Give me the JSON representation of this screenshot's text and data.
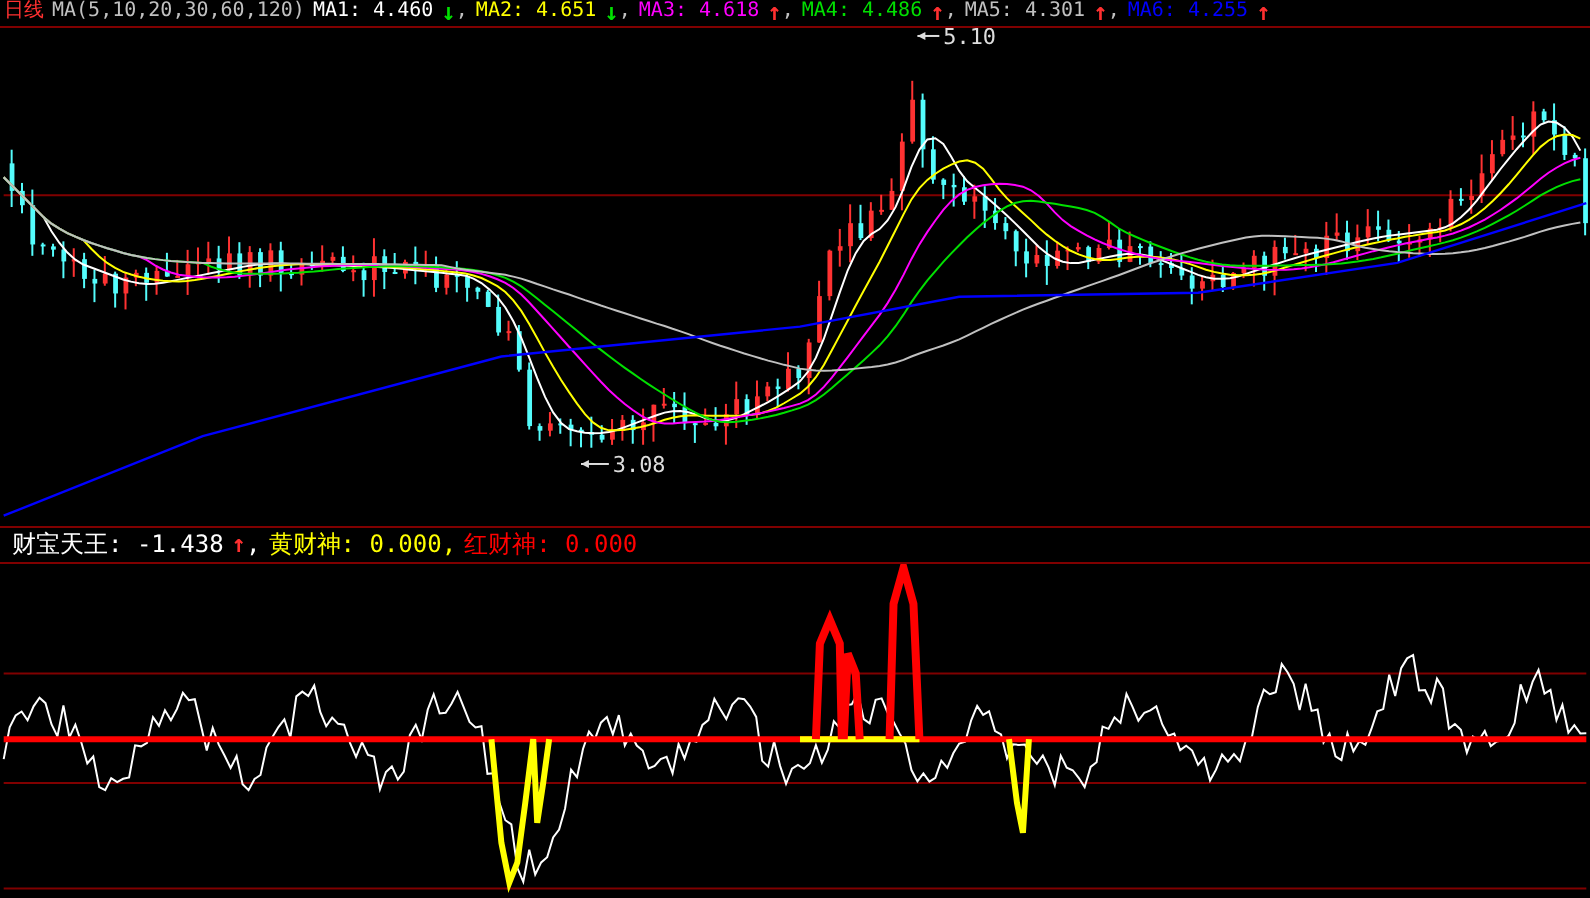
{
  "header": {
    "period": "日线",
    "ma_params": "MA(5,10,20,30,60,120)",
    "mas": [
      {
        "label": "MA1:",
        "value": "4.460",
        "arrow": {
          "glyph": "↓",
          "color": "#00e000"
        },
        "sep": ",",
        "color": "#ffffff"
      },
      {
        "label": "MA2:",
        "value": "4.651",
        "arrow": {
          "glyph": "↓",
          "color": "#00e000"
        },
        "sep": ",",
        "color": "#ffff00"
      },
      {
        "label": "MA3:",
        "value": "4.618",
        "arrow": {
          "glyph": "↑",
          "color": "#ff3030"
        },
        "sep": ",",
        "color": "#ff00ff"
      },
      {
        "label": "MA4:",
        "value": "4.486",
        "arrow": {
          "glyph": "↑",
          "color": "#ff3030"
        },
        "sep": ",",
        "color": "#00e000"
      },
      {
        "label": "MA5:",
        "value": "4.301",
        "arrow": {
          "glyph": "↑",
          "color": "#ff3030"
        },
        "sep": ",",
        "color": "#c0c0c0"
      },
      {
        "label": "MA6:",
        "value": "4.255",
        "arrow": {
          "glyph": "↑",
          "color": "#ff3030"
        },
        "color": "#0000ff"
      }
    ]
  },
  "price_chart": {
    "high_label": "5.10",
    "low_label": "3.08"
  },
  "indicator": {
    "items": [
      {
        "label": "财宝天王:",
        "value": "-1.438",
        "arrow": {
          "glyph": "↑",
          "color": "#ff3030"
        },
        "sep": ",",
        "color": "#ffffff"
      },
      {
        "label": "黄财神:",
        "value": "0.000",
        "sep": ",",
        "color": "#ffff00"
      },
      {
        "label": "红财神:",
        "value": "0.000",
        "color": "#ff0000"
      }
    ]
  }
}
